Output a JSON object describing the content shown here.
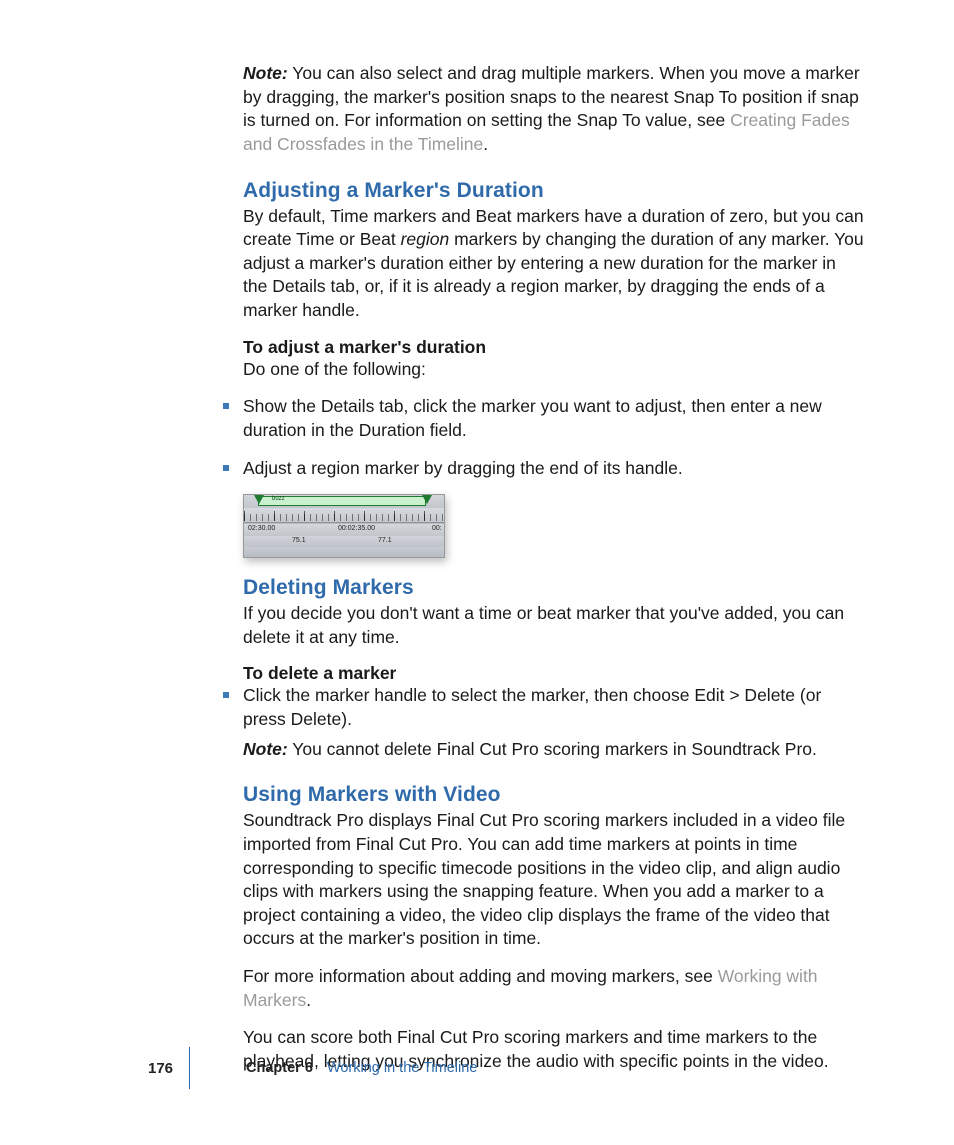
{
  "intro_note": {
    "label": "Note:",
    "text_a": "You can also select and drag multiple markers. When you move a marker by dragging, the marker's position snaps to the nearest Snap To position if snap is turned on. For information on setting the Snap To value, see ",
    "link": "Creating Fades and Crossfades in the Timeline",
    "text_b": "."
  },
  "sec1": {
    "heading": "Adjusting a Marker's Duration",
    "para_a": "By default, Time markers and Beat markers have a duration of zero, but you can create Time or Beat ",
    "para_ital": "region",
    "para_b": " markers by changing the duration of any marker. You adjust a marker's duration either by entering a new duration for the marker in the Details tab, or, if it is already a region marker, by dragging the ends of a marker handle.",
    "subhead": "To adjust a marker's duration",
    "subtext": "Do one of the following:",
    "bullets": [
      "Show the Details tab, click the marker you want to adjust, then enter a new duration in the Duration field.",
      "Adjust a region marker by dragging the end of its handle."
    ]
  },
  "figure": {
    "region_label": "buzz",
    "tc1": "02:30.00",
    "tc2": "00:02:35.00",
    "tc3": "00:",
    "beat1": "75.1",
    "beat2": "77.1"
  },
  "sec2": {
    "heading": "Deleting Markers",
    "para": "If you decide you don't want a time or beat marker that you've added, you can delete it at any time.",
    "subhead": "To delete a marker",
    "bullet": "Click the marker handle to select the marker, then choose Edit > Delete (or press Delete).",
    "note_label": "Note:",
    "note_text": "You cannot delete Final Cut Pro scoring markers in Soundtrack Pro."
  },
  "sec3": {
    "heading": "Using Markers with Video",
    "para1": "Soundtrack Pro displays Final Cut Pro scoring markers included in a video file imported from Final Cut Pro. You can add time markers at points in time corresponding to specific timecode positions in the video clip, and align audio clips with markers using the snapping feature. When you add a marker to a project containing a video, the video clip displays the frame of the video that occurs at the marker's position in time.",
    "para2a": "For more information about adding and moving markers, see ",
    "para2link": "Working with Markers",
    "para2b": ".",
    "para3": "You can score both Final Cut Pro scoring markers and time markers to the playhead, letting you synchronize the audio with specific points in the video."
  },
  "footer": {
    "page": "176",
    "chapter_label": "Chapter 6",
    "chapter_title": "Working in the Timeline"
  }
}
